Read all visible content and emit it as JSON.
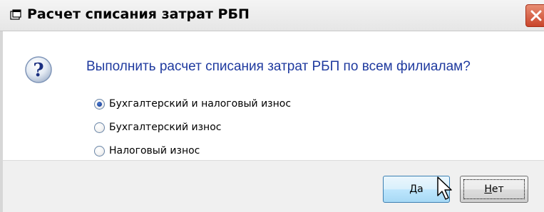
{
  "window": {
    "title": "Расчет списания затрат РБП",
    "close_icon": "close-icon"
  },
  "dialog": {
    "icon": "question-icon",
    "question": "Выполнить расчет списания затрат РБП по всем филиалам?",
    "options": [
      {
        "label": "Бухгалтерский и налоговый износ",
        "checked": true
      },
      {
        "label": "Бухгалтерский износ",
        "checked": false
      },
      {
        "label": "Налоговый износ",
        "checked": false
      }
    ]
  },
  "buttons": {
    "yes_mnemonic": "Д",
    "yes_rest": "а",
    "no_mnemonic": "Н",
    "no_rest": "ет"
  },
  "colors": {
    "question_text": "#1f3a9f",
    "close_button": "#c9452b"
  }
}
